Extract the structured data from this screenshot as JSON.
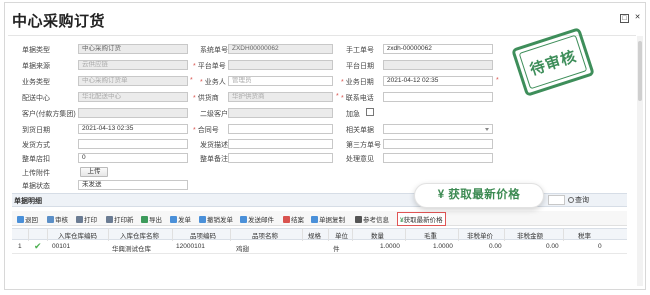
{
  "window": {
    "title": "中心采购订货",
    "restore_icon": "□",
    "close_icon": "✕"
  },
  "form": {
    "doc_type": {
      "label": "单据类型",
      "value": "中心采购订货"
    },
    "system_no": {
      "label": "系统单号",
      "value": "ZXDH00000062"
    },
    "manual_no": {
      "label": "手工单号",
      "value": "zxdh-00000062"
    },
    "doc_source": {
      "label": "单据来源",
      "placeholder": "云供应链"
    },
    "platform_no": {
      "label": "平台单号",
      "value": ""
    },
    "platform_date": {
      "label": "平台日期",
      "value": ""
    },
    "biz_type": {
      "label": "业务类型",
      "value": "中心采购订货单"
    },
    "biz_person": {
      "label": "业务人",
      "value": "管理员"
    },
    "biz_date": {
      "label": "业务日期",
      "value": "2021-04-12 02:35"
    },
    "dist_center": {
      "label": "配送中心",
      "value": "华北配送中心"
    },
    "supplier": {
      "label": "供货商",
      "value": "华护供货商"
    },
    "contact_phone": {
      "label": "联系电话",
      "value": ""
    },
    "customer_group": {
      "label": "客户(付款方集团)",
      "value": ""
    },
    "secondary_customer": {
      "label": "二级客户",
      "value": ""
    },
    "expedite": {
      "label": "加急"
    },
    "arrival_date": {
      "label": "到货日期",
      "value": "2021-04-13 02:35"
    },
    "contract_no": {
      "label": "合同号",
      "value": ""
    },
    "related_doc": {
      "label": "相关单据",
      "value": ""
    },
    "ship_method": {
      "label": "发货方式",
      "value": ""
    },
    "ship_desc": {
      "label": "发货描述",
      "value": ""
    },
    "third_party_no": {
      "label": "第三方单号",
      "value": ""
    },
    "order_discount": {
      "label": "整单店扣",
      "value": "0"
    },
    "order_note": {
      "label": "整单备注",
      "value": ""
    },
    "handling_opinion": {
      "label": "处理意见",
      "value": ""
    },
    "attachment": {
      "label": "上传附件",
      "button": "上传"
    },
    "doc_status": {
      "label": "单据状态",
      "value": "未发送"
    }
  },
  "stamp": {
    "text": "待审核"
  },
  "detail": {
    "section_title": "单据明细",
    "search_label": "查询",
    "toolbar": [
      {
        "label": "退回",
        "icon": "return-icon",
        "color": "#4a90d9"
      },
      {
        "label": "审核",
        "icon": "approve-icon",
        "color": "#5b8fc7"
      },
      {
        "label": "打印",
        "icon": "print-icon",
        "color": "#6b7c93"
      },
      {
        "label": "打印新",
        "icon": "print-new-icon",
        "color": "#6b7c93"
      },
      {
        "label": "导出",
        "icon": "export-icon",
        "color": "#3d9b5c"
      },
      {
        "label": "发单",
        "icon": "send-order-icon",
        "color": "#4a90d9"
      },
      {
        "label": "撤销发单",
        "icon": "revoke-icon",
        "color": "#4a90d9"
      },
      {
        "label": "发送邮件",
        "icon": "email-icon",
        "color": "#4a90d9"
      },
      {
        "label": "结案",
        "icon": "close-case-icon",
        "color": "#d9534f"
      },
      {
        "label": "单据复制",
        "icon": "copy-icon",
        "color": "#4a90d9"
      },
      {
        "label": "参考信息",
        "icon": "info-icon",
        "color": "#555555"
      },
      {
        "label": "获取最新价格",
        "icon": "yen-icon",
        "color": "#4a9a5e"
      }
    ],
    "callout": "¥ 获取最新价格",
    "columns": [
      "入库仓库编码",
      "入库仓库名称",
      "品项编码",
      "品项名称",
      "规格",
      "单位",
      "数量",
      "毛重",
      "非税单价",
      "非税金额",
      "税率"
    ],
    "rows": [
      {
        "index": "1",
        "warehouse_code": "00101",
        "warehouse_name": "华興测试仓库",
        "item_code": "12000101",
        "item_name": "鸡翅",
        "spec": "",
        "unit": "件",
        "qty": "1.0000",
        "gross": "1.0000",
        "price": "0.00",
        "amount": "0.00",
        "tax": "0"
      }
    ]
  }
}
